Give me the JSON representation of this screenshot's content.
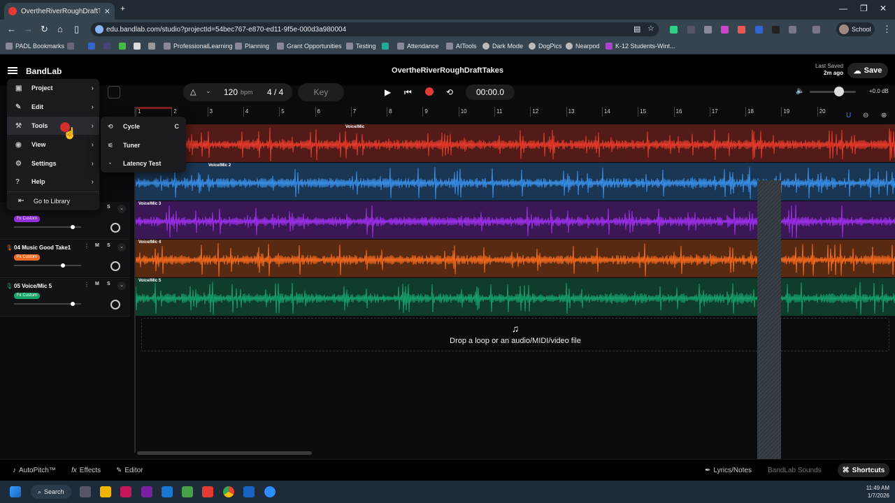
{
  "browser": {
    "tab_title": "OvertheRiverRoughDraftTak",
    "url": "edu.bandlab.com/studio?projectId=54bec767-e870-ed11-9f5e-000d3a980004",
    "profile": "School",
    "bookmarks": [
      "PADL Bookmarks",
      "ProfessionalLearning",
      "Planning",
      "Grant Opportunities",
      "Testing",
      "Attendance",
      "AITools",
      "Dark Mode",
      "DogPics",
      "Nearpod",
      "K-12 Students-Wint..."
    ]
  },
  "app": {
    "logo": "BandLab",
    "project_title": "OvertheRiverRoughDraftTakes",
    "last_saved_label": "Last Saved",
    "last_saved_value": "2m ago",
    "save_label": "Save"
  },
  "toolbar": {
    "tempo": "120",
    "tempo_unit": "bpm",
    "time_signature": "4 / 4",
    "key_label": "Key",
    "time": "00:00.0",
    "master_volume": "+0.0 dB",
    "volume_level": 0.6
  },
  "ruler": [
    "1",
    "2",
    "3",
    "4",
    "5",
    "6",
    "7",
    "8",
    "9",
    "10",
    "11",
    "12",
    "13",
    "14",
    "15",
    "16",
    "17",
    "18",
    "19",
    "20"
  ],
  "tracks": [
    {
      "region": "Voice/Mic",
      "color": "#e53b2c"
    },
    {
      "region": "Voice/Mic 2",
      "color": "#3a8ee6"
    },
    {
      "region": "Voice/Mic 3",
      "color": "#9b30e8"
    },
    {
      "region": "Voice/Mic 4",
      "color": "#f26a1f"
    },
    {
      "region": "Voice/Mic 5",
      "color": "#17a06a"
    }
  ],
  "track_headers": [
    {
      "name": "",
      "fx": "Fx Custom",
      "fx_color": "#9b30e8",
      "m": "M",
      "s": "S",
      "fader": 0.88
    },
    {
      "name": "04  Music Good Take1",
      "fx": "Fx Custom",
      "fx_color": "#f26a1f",
      "m": "M",
      "s": "S",
      "fader": 0.73
    },
    {
      "name": "05  Voice/Mic 5",
      "fx": "Fx Custom",
      "fx_color": "#17a06a",
      "m": "M",
      "s": "S",
      "fader": 0.88
    }
  ],
  "drop_text": "Drop a loop or an audio/MIDI/video file",
  "main_menu": [
    {
      "label": "Project",
      "icon": "project-icon"
    },
    {
      "label": "Edit",
      "icon": "pencil-icon"
    },
    {
      "label": "Tools",
      "icon": "tools-icon"
    },
    {
      "label": "View",
      "icon": "eye-icon"
    },
    {
      "label": "Settings",
      "icon": "gear-icon"
    },
    {
      "label": "Help",
      "icon": "help-icon"
    },
    {
      "label": "Go to Library",
      "icon": "exit-icon"
    }
  ],
  "tools_menu": [
    {
      "label": "Cycle",
      "shortcut": "C"
    },
    {
      "label": "Tuner",
      "shortcut": ""
    },
    {
      "label": "Latency Test",
      "shortcut": ""
    }
  ],
  "footer": {
    "autopitch": "AutoPitch™",
    "effects": "Effects",
    "editor": "Editor",
    "lyrics": "Lyrics/Notes",
    "sounds": "BandLab Sounds",
    "shortcuts": "Shortcuts"
  },
  "taskbar": {
    "search": "Search",
    "time": "11:49 AM",
    "date": "1/7/2026"
  }
}
